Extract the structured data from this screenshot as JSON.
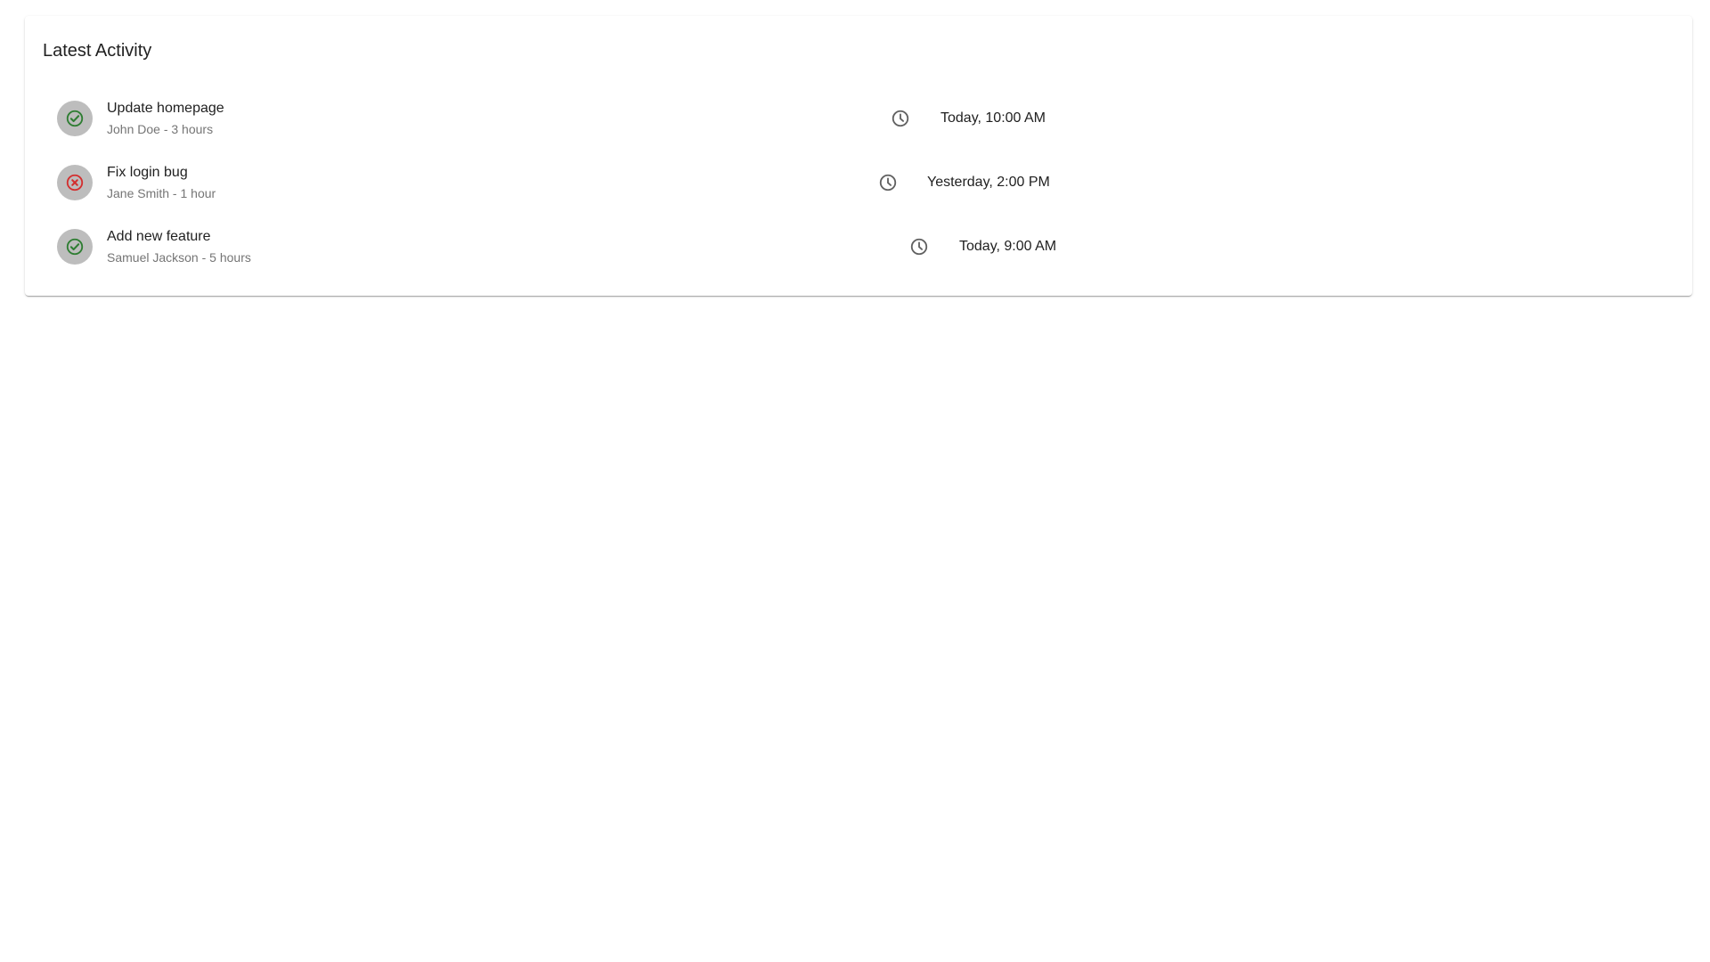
{
  "card": {
    "title": "Latest Activity"
  },
  "activities": [
    {
      "title": "Update homepage",
      "subtitle": "John Doe - 3 hours",
      "status": "success",
      "status_icon": "check-circle-icon",
      "status_color": "#2e7d32",
      "time_icon": "clock-icon",
      "time": "Today, 10:00 AM"
    },
    {
      "title": "Fix login bug",
      "subtitle": "Jane Smith - 1 hour",
      "status": "error",
      "status_icon": "x-circle-icon",
      "status_color": "#d32f2f",
      "time_icon": "clock-icon",
      "time": "Yesterday, 2:00 PM"
    },
    {
      "title": "Add new feature",
      "subtitle": "Samuel Jackson - 5 hours",
      "status": "success",
      "status_icon": "check-circle-icon",
      "status_color": "#2e7d32",
      "time_icon": "clock-icon",
      "time": "Today, 9:00 AM"
    }
  ],
  "colors": {
    "avatar_bg": "#bdbdbd",
    "clock": "#616161",
    "secondary_text": "#757575"
  }
}
